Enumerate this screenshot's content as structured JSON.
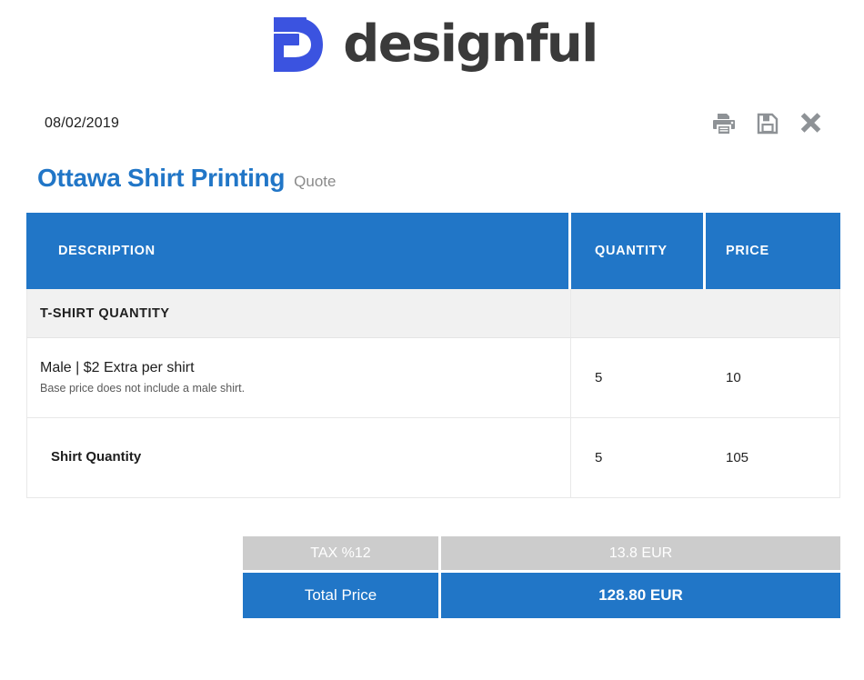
{
  "brand": {
    "wordmark": "designful",
    "logo_icon": "designful-d-logo-icon",
    "logo_color": "#3b53e0",
    "wordmark_color": "#3a3a3a"
  },
  "meta": {
    "date": "08/02/2019",
    "actions": [
      {
        "name": "print-button",
        "icon": "printer-icon",
        "label": "Print"
      },
      {
        "name": "save-button",
        "icon": "floppy-disk-save-icon",
        "label": "Save"
      },
      {
        "name": "close-button",
        "icon": "close-x-icon",
        "label": "Close"
      }
    ],
    "icon_color": "#8e9296"
  },
  "header": {
    "project_title": "Ottawa Shirt Printing",
    "doc_type": "Quote",
    "title_color": "#2176c7"
  },
  "table": {
    "columns": [
      {
        "key": "description",
        "label": "DESCRIPTION"
      },
      {
        "key": "quantity",
        "label": "QUANTITY"
      },
      {
        "key": "price",
        "label": "PRICE"
      }
    ],
    "header_bg": "#2176c7",
    "rows": [
      {
        "type": "section",
        "label": "T-SHIRT QUANTITY"
      },
      {
        "type": "item",
        "name": "Male | $2 Extra per shirt",
        "note": "Base price does not include a male shirt.",
        "quantity": "5",
        "price": "10",
        "indented": false
      },
      {
        "type": "item",
        "name": "Shirt Quantity",
        "note": "",
        "quantity": "5",
        "price": "105",
        "indented": true
      }
    ]
  },
  "totals": {
    "tax": {
      "label": "TAX %12",
      "value": "13.8 EUR",
      "bg": "#cccccc"
    },
    "total": {
      "label": "Total Price",
      "value": "128.80 EUR",
      "bg": "#2176c7"
    }
  }
}
